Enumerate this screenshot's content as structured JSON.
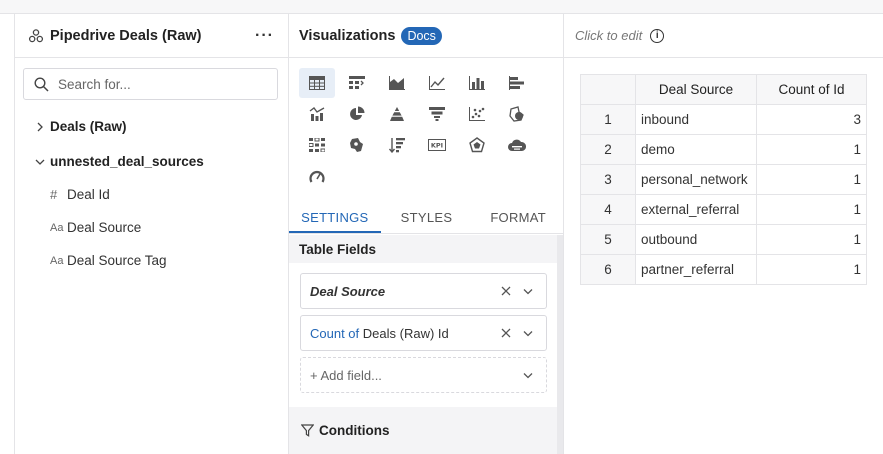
{
  "left_panel": {
    "title": "Pipedrive Deals (Raw)",
    "more_label": "···",
    "search_placeholder": "Search for...",
    "tree": [
      {
        "label": "Deals (Raw)",
        "expanded": false
      },
      {
        "label": "unnested_deal_sources",
        "expanded": true
      }
    ],
    "fields": [
      {
        "type_glyph": "#",
        "label": "Deal Id"
      },
      {
        "type_glyph": "Aa",
        "label": "Deal Source"
      },
      {
        "type_glyph": "Aa",
        "label": "Deal Source Tag"
      }
    ]
  },
  "middle_panel": {
    "title": "Visualizations",
    "docs_label": "Docs",
    "viz_icons": [
      "table-icon",
      "pivot-table-icon",
      "area-chart-icon",
      "line-chart-icon",
      "bar-chart-icon",
      "horizontal-bar-icon",
      "combo-chart-icon",
      "pie-chart-icon",
      "pyramid-icon",
      "funnel-icon",
      "scatter-icon",
      "bubble-map-icon",
      "heatmap-icon",
      "region-map-icon",
      "sorted-bar-icon",
      "kpi-icon",
      "radar-icon",
      "word-cloud-icon",
      "gauge-icon"
    ],
    "tabs": [
      "SETTINGS",
      "STYLES",
      "FORMAT"
    ],
    "active_tab": "SETTINGS",
    "table_fields_heading": "Table Fields",
    "table_fields": [
      {
        "prefix": "",
        "name": "Deal Source",
        "suffix": ""
      },
      {
        "prefix": "Count of",
        "name": "Deals (Raw)",
        "suffix": "Id"
      }
    ],
    "add_field_label": "+ Add field...",
    "conditions_heading": "Conditions"
  },
  "right_panel": {
    "edit_hint": "Click to edit",
    "info_glyph": "i",
    "table": {
      "columns": [
        "",
        "Deal Source",
        "Count of Id"
      ],
      "rows": [
        [
          "1",
          "inbound",
          "3"
        ],
        [
          "2",
          "demo",
          "1"
        ],
        [
          "3",
          "personal_network",
          "1"
        ],
        [
          "4",
          "external_referral",
          "1"
        ],
        [
          "5",
          "outbound",
          "1"
        ],
        [
          "6",
          "partner_referral",
          "1"
        ]
      ]
    }
  },
  "colors": {
    "accent": "#2367b6",
    "border": "#e4e4e7",
    "panel_bg": "#f4f4f6"
  }
}
